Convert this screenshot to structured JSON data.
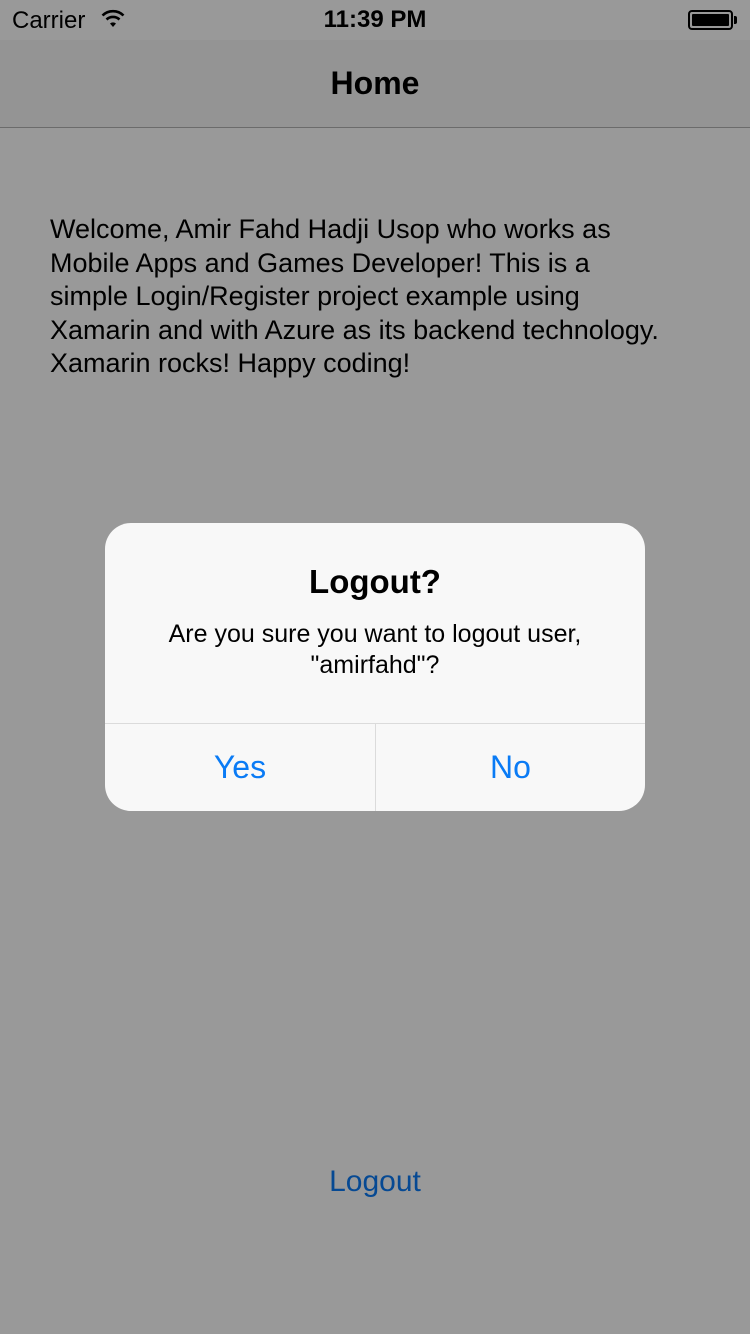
{
  "status_bar": {
    "carrier": "Carrier",
    "time": "11:39 PM",
    "wifi_icon": "wifi-icon",
    "battery_icon": "battery-icon"
  },
  "nav": {
    "title": "Home"
  },
  "main": {
    "welcome_text": "Welcome, Amir Fahd Hadji Usop who works as Mobile Apps and Games Developer! This is a simple Login/Register project example using Xamarin and with Azure as its backend technology. Xamarin rocks! Happy coding!",
    "logout_label": "Logout"
  },
  "alert": {
    "title": "Logout?",
    "message": "Are you sure you want to logout user, \"amirfahd\"?",
    "yes_label": "Yes",
    "no_label": "No"
  },
  "colors": {
    "accent": "#0a7bf5",
    "dim_overlay": "rgba(0,0,0,0.4)"
  }
}
